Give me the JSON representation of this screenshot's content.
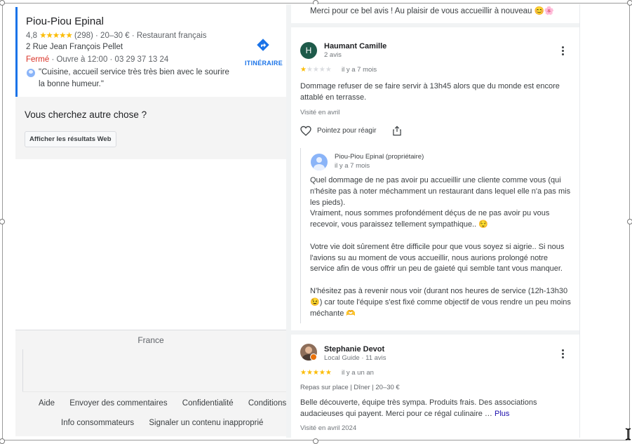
{
  "business": {
    "name": "Piou-Piou Epinal",
    "rating": "4,8",
    "stars": "★★★★★",
    "review_count": "(298)",
    "price_category": "· 20–30 € · Restaurant français",
    "address": "2 Rue Jean François Pellet",
    "status": "Fermé",
    "hours_phone": "· Ouvre à 12:00 · 03 29 37 13 24",
    "quote": "\"Cuisine, accueil service très très bien avec le sourire la bonne humeur.\"",
    "directions_label": "ITINÉRAIRE",
    "directions_icon": "directions-icon"
  },
  "search_more": {
    "title": "Vous cherchez autre chose ?",
    "web_button": "Afficher les résultats Web"
  },
  "footer": {
    "country": "France",
    "links_row1": [
      "Aide",
      "Envoyer des commentaires",
      "Confidentialité",
      "Conditions"
    ],
    "links_row2": [
      "Info consommateurs",
      "Signaler un contenu inapproprié"
    ]
  },
  "previous_reply_tail": "Merci pour ce bel avis ! Au plaisir de vous accueillir à nouveau 😊🌸",
  "reviews": [
    {
      "initial": "H",
      "name": "Haumant Camille",
      "sub": "2 avis",
      "rating": 1,
      "date": "il y a 7 mois",
      "text": "Dommage refuser de se faire servir à 13h45 alors que du monde est encore attablé en terrasse.",
      "visited": "Visité en avril",
      "react_label": "Pointez pour réagir",
      "owner_reply": {
        "name": "Piou-Piou Epinal (propriétaire)",
        "date": "il y a 7 mois",
        "paragraphs": [
          "Quel dommage de ne pas avoir pu accueillir une cliente comme vous (qui n'hésite pas à noter méchamment un restaurant dans lequel elle n'a pas mis les pieds).",
          "Vraiment, nous sommes profondément déçus de ne pas avoir pu vous recevoir, vous paraissez tellement sympathique.. 😌",
          "Votre vie doit sûrement être difficile pour que vous soyez si aigrie.. Si nous l'avions su au moment de vous accueillir, nous aurions prolongé notre service afin de vous offrir un peu de gaieté qui semble tant vous manquer.",
          "N'hésitez pas à revenir nous voir (durant nos heures de service (12h-13h30 😉) car toute l'équipe s'est fixé comme objectif de vous rendre un peu moins méchante 🫶"
        ]
      }
    },
    {
      "name": "Stephanie Devot",
      "sub": "Local Guide · 11 avis",
      "rating": 5,
      "date": "il y a un an",
      "tags": "Repas sur place  |  Dîner  |  20–30 €",
      "text": "Belle découverte, équipe très sympa. Produits frais. Des associations audacieuses qui payent. Merci pour ce régal culinaire …",
      "more_link": "Plus",
      "visited": "Visité en avril 2024"
    }
  ],
  "colors": {
    "accent_blue": "#1a73e8",
    "closed_red": "#d93025",
    "star_yellow": "#fbbc04"
  }
}
